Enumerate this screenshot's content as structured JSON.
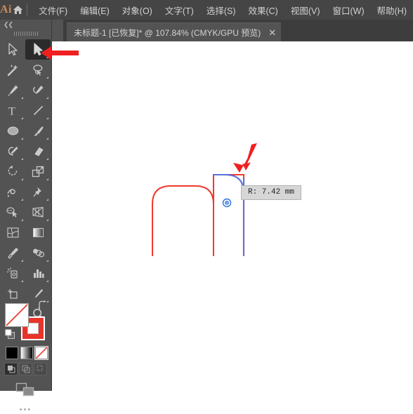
{
  "app": {
    "name": "Ai",
    "logo_color": "#c98a5e",
    "home_icon": "home-icon"
  },
  "menu": {
    "items": [
      {
        "label": "文件(F)",
        "name": "menu-file"
      },
      {
        "label": "编辑(E)",
        "name": "menu-edit"
      },
      {
        "label": "对象(O)",
        "name": "menu-object"
      },
      {
        "label": "文字(T)",
        "name": "menu-type"
      },
      {
        "label": "选择(S)",
        "name": "menu-select"
      },
      {
        "label": "效果(C)",
        "name": "menu-effect"
      },
      {
        "label": "视图(V)",
        "name": "menu-view"
      },
      {
        "label": "窗口(W)",
        "name": "menu-window"
      },
      {
        "label": "帮助(H)",
        "name": "menu-help"
      }
    ]
  },
  "tab": {
    "title": "未标题-1 [已恢复]* @ 107.84% (CMYK/GPU 预览)",
    "document_name": "未标题-1",
    "recovered_label": "[已恢复]",
    "modified_marker": "*",
    "zoom": "107.84%",
    "color_mode": "CMYK/GPU 预览",
    "close_label": "✕"
  },
  "toolbar": {
    "collapse_label": "❮❮",
    "tools": [
      {
        "name": "selection-tool",
        "title": "选择工具",
        "selected": false
      },
      {
        "name": "direct-selection-tool",
        "title": "直接选择工具",
        "selected": true
      },
      {
        "name": "magic-wand-tool",
        "title": "魔棒工具",
        "selected": false
      },
      {
        "name": "lasso-tool",
        "title": "套索工具",
        "selected": false
      },
      {
        "name": "pen-tool",
        "title": "钢笔工具",
        "selected": false
      },
      {
        "name": "curvature-tool",
        "title": "曲率工具",
        "selected": false
      },
      {
        "name": "type-tool",
        "title": "文字工具",
        "selected": false
      },
      {
        "name": "line-segment-tool",
        "title": "直线段工具",
        "selected": false
      },
      {
        "name": "ellipse-tool",
        "title": "椭圆工具",
        "selected": false
      },
      {
        "name": "paintbrush-tool",
        "title": "画笔工具",
        "selected": false
      },
      {
        "name": "shaper-tool",
        "title": "Shaper 工具",
        "selected": false
      },
      {
        "name": "eraser-tool",
        "title": "橡皮擦工具",
        "selected": false
      },
      {
        "name": "rotate-tool",
        "title": "旋转工具",
        "selected": false
      },
      {
        "name": "scale-tool",
        "title": "比例缩放工具",
        "selected": false
      },
      {
        "name": "width-tool",
        "title": "宽度工具",
        "selected": false
      },
      {
        "name": "free-transform-tool",
        "title": "自由变换工具",
        "selected": false
      },
      {
        "name": "shape-builder-tool",
        "title": "形状生成器工具",
        "selected": false
      },
      {
        "name": "perspective-grid-tool",
        "title": "透视网格工具",
        "selected": false
      },
      {
        "name": "mesh-tool",
        "title": "网格工具",
        "selected": false
      },
      {
        "name": "gradient-tool",
        "title": "渐变工具",
        "selected": false
      },
      {
        "name": "eyedropper-tool",
        "title": "吸管工具",
        "selected": false
      },
      {
        "name": "blend-tool",
        "title": "混合工具",
        "selected": false
      },
      {
        "name": "symbol-sprayer-tool",
        "title": "符号喷枪工具",
        "selected": false
      },
      {
        "name": "column-graph-tool",
        "title": "柱形图工具",
        "selected": false
      },
      {
        "name": "artboard-tool",
        "title": "画板工具",
        "selected": false
      },
      {
        "name": "slice-tool",
        "title": "切片工具",
        "selected": false
      },
      {
        "name": "hand-tool",
        "title": "抓手工具",
        "selected": false
      },
      {
        "name": "zoom-tool",
        "title": "缩放工具",
        "selected": false
      }
    ],
    "fill": {
      "name": "fill-swatch",
      "color": "#ffffff",
      "is_none": true
    },
    "stroke": {
      "name": "stroke-swatch",
      "color": "#e8342a"
    },
    "swap_icon": "swap-fill-stroke-icon",
    "default_icon": "default-fill-stroke-icon",
    "color_modes": [
      {
        "name": "color-mode-button",
        "label": "颜色",
        "selected": false
      },
      {
        "name": "gradient-mode-button",
        "label": "渐变",
        "selected": false
      },
      {
        "name": "none-mode-button",
        "label": "无",
        "selected": true
      }
    ],
    "draw_modes": [
      {
        "name": "draw-normal-button",
        "selected": true
      },
      {
        "name": "draw-behind-button",
        "selected": false
      },
      {
        "name": "draw-inside-button",
        "selected": false
      }
    ],
    "screen_mode": {
      "name": "change-screen-mode-button"
    },
    "more_label": "•••"
  },
  "canvas": {
    "shapes": [
      {
        "name": "rounded-rect-left",
        "stroke": "#f0392c",
        "corner": "rounded"
      },
      {
        "name": "rounded-rect-right",
        "stroke": "#f0392c",
        "corner": "live-corner-editing"
      },
      {
        "name": "corner-preview-arc",
        "stroke": "#5b6fd8"
      },
      {
        "name": "right-edge-highlight",
        "stroke": "#7b68c8"
      }
    ],
    "corner_widget": {
      "name": "live-corner-widget",
      "color": "#2b6fe0"
    },
    "tooltip": {
      "name": "radius-tooltip",
      "label": "R:",
      "value": "7.42",
      "unit": "mm",
      "text": "R:  7.42  mm"
    }
  },
  "annotations": [
    {
      "name": "arrow-to-direct-selection-tool",
      "color": "#f02020",
      "points_to": "direct-selection-tool"
    },
    {
      "name": "arrow-to-corner-widget",
      "color": "#f02020",
      "points_to": "live-corner-widget"
    }
  ]
}
